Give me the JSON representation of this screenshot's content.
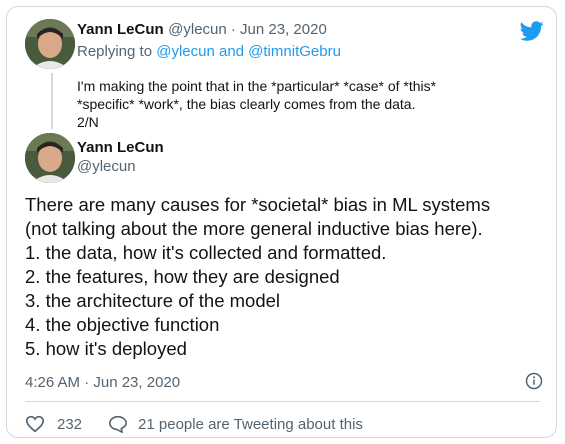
{
  "reply_tweet": {
    "display_name": "Yann LeCun",
    "handle_date": "@ylecun · Jun 23, 2020",
    "replying_prefix": "Replying to ",
    "replying_handles": "@ylecun and @timnitGebru",
    "lines": [
      "I'm making the point that in the *particular* *case* of *this*",
      "*specific* *work*, the bias clearly comes from the data.",
      "2/N"
    ]
  },
  "main_tweet": {
    "display_name": "Yann LeCun",
    "handle": "@ylecun",
    "lines": [
      "There are many causes for *societal* bias in ML systems",
      "(not talking about the more general inductive bias here).",
      "1. the data, how it's collected and formatted.",
      "2. the features, how they are designed",
      "3. the architecture of the model",
      "4. the objective function",
      "5. how it's deployed"
    ],
    "timestamp": "4:26 AM · Jun 23, 2020",
    "like_count": "232",
    "tweeting_label": "21 people are Tweeting about this"
  },
  "icons": {
    "brand": "twitter-bird-icon",
    "info": "info-icon",
    "like": "heart-icon",
    "reply": "speech-bubble-icon"
  },
  "colors": {
    "accent": "#1d9bf0",
    "muted": "#536471",
    "border": "#cfd9de"
  }
}
